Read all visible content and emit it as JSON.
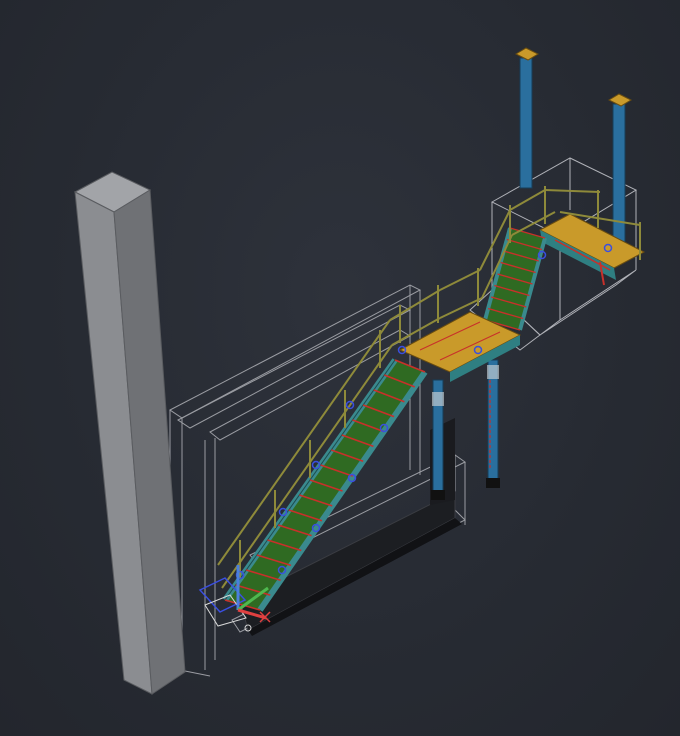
{
  "viewport": {
    "background": "#272b33",
    "view_style": "realistic-3d",
    "projection": "isometric"
  },
  "model": {
    "objects": [
      "concrete-column",
      "staircase",
      "upper-staircase",
      "landing",
      "top-platform",
      "support-posts",
      "handrails",
      "wall-outline",
      "base-footing"
    ]
  },
  "colors": {
    "column": "#8a8c91",
    "stringer": "#3a8a8e",
    "tread_green": "#2f6a22",
    "tread_red": "#c8302a",
    "handrail": "#8e8a3a",
    "landing_deck": "#c99a2a",
    "post_blue": "#2a6f9e",
    "bolt_blue": "#3a4fe0",
    "outline_white": "#d8d8d8",
    "ucs_x": "#e04040",
    "ucs_y": "#4fb84f",
    "ucs_z": "#4a7fdc"
  },
  "ucs_icon": {
    "axes": [
      "X",
      "Y",
      "Z"
    ]
  }
}
